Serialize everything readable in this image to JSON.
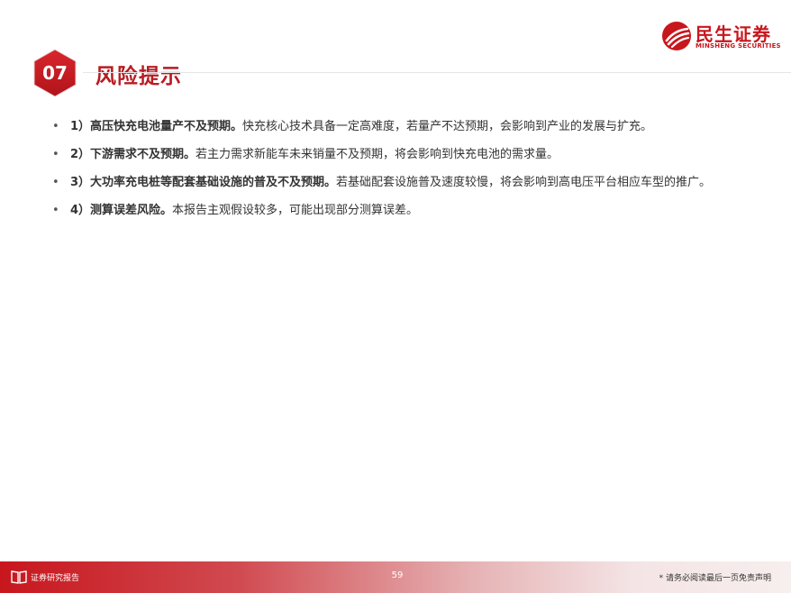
{
  "header": {
    "section_number": "07",
    "section_title": "风险提示"
  },
  "logo": {
    "name": "民生证券",
    "subtitle": "MINSHENG SECURITIES"
  },
  "risks": [
    {
      "head": "1）高压快充电池量产不及预期。",
      "body": "快充核心技术具备一定高难度，若量产不达预期，会影响到产业的发展与扩充。"
    },
    {
      "head": "2）下游需求不及预期。",
      "body": "若主力需求新能车未来销量不及预期，将会影响到快充电池的需求量。"
    },
    {
      "head": "3）大功率充电桩等配套基础设施的普及不及预期。",
      "body": "若基础配套设施普及速度较慢，将会影响到高电压平台相应车型的推广。"
    },
    {
      "head": "4）测算误差风险。",
      "body": "本报告主观假设较多，可能出现部分测算误差。"
    }
  ],
  "bullet_symbol": "•",
  "footer": {
    "left_label": "证券研究报告",
    "page_number": "59",
    "disclaimer": "* 请务必阅读最后一页免责声明"
  },
  "colors": {
    "brand_red": "#c8161d",
    "title_red": "#b81c22"
  }
}
